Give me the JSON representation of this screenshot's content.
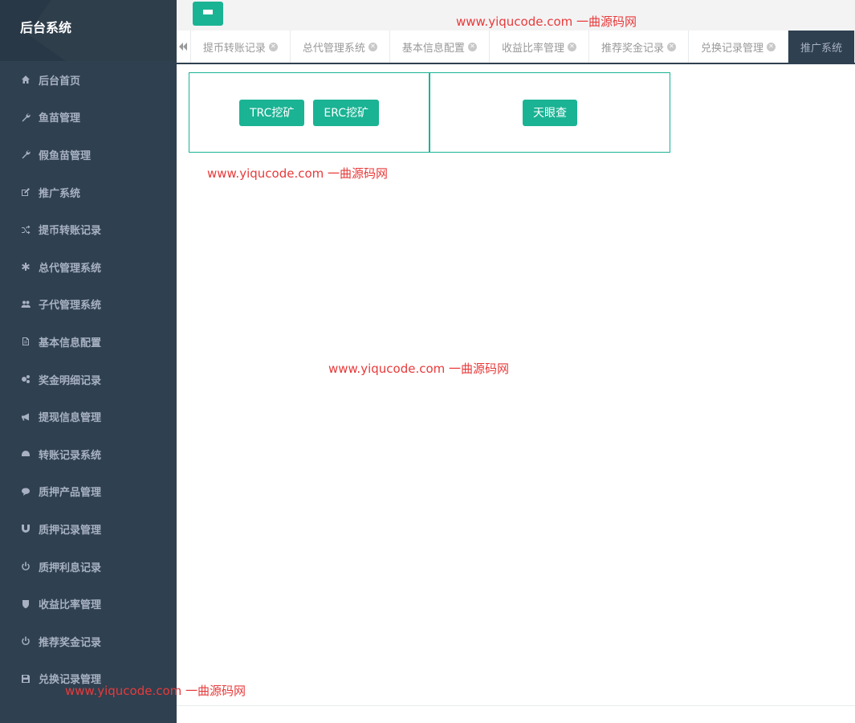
{
  "brand": {
    "title": "后台系统"
  },
  "sidebar": {
    "items": [
      {
        "label": "后台首页",
        "icon": "home-icon"
      },
      {
        "label": "鱼苗管理",
        "icon": "wrench-icon"
      },
      {
        "label": "假鱼苗管理",
        "icon": "wrench-icon"
      },
      {
        "label": "推广系统",
        "icon": "edit-icon"
      },
      {
        "label": "提币转账记录",
        "icon": "shuffle-icon"
      },
      {
        "label": "总代管理系统",
        "icon": "asterisk-icon"
      },
      {
        "label": "子代管理系统",
        "icon": "users-icon"
      },
      {
        "label": "基本信息配置",
        "icon": "file-icon"
      },
      {
        "label": "奖金明细记录",
        "icon": "cogs-icon"
      },
      {
        "label": "提现信息管理",
        "icon": "bullhorn-icon"
      },
      {
        "label": "转账记录系统",
        "icon": "dashboard-icon"
      },
      {
        "label": "质押产品管理",
        "icon": "comment-icon"
      },
      {
        "label": "质押记录管理",
        "icon": "magnet-icon"
      },
      {
        "label": "质押利息记录",
        "icon": "power-icon"
      },
      {
        "label": "收益比率管理",
        "icon": "shield-icon"
      },
      {
        "label": "推荐奖金记录",
        "icon": "power-icon"
      },
      {
        "label": "兑换记录管理",
        "icon": "save-icon"
      }
    ]
  },
  "tabs": [
    {
      "label": "提币转账记录",
      "closable": true,
      "active": false
    },
    {
      "label": "总代管理系统",
      "closable": true,
      "active": false
    },
    {
      "label": "基本信息配置",
      "closable": true,
      "active": false
    },
    {
      "label": "收益比率管理",
      "closable": true,
      "active": false
    },
    {
      "label": "推荐奖金记录",
      "closable": true,
      "active": false
    },
    {
      "label": "兑换记录管理",
      "closable": true,
      "active": false
    },
    {
      "label": "推广系统",
      "closable": false,
      "active": true
    }
  ],
  "content": {
    "panel_a_buttons": [
      "TRC挖矿",
      "ERC挖矿"
    ],
    "panel_b_buttons": [
      "天眼查"
    ]
  },
  "watermark": "www.yiqucode.com  一曲源码网",
  "colors": {
    "accent": "#1ab394",
    "sidebar": "#2f4050",
    "watermark": "#e83a3a"
  }
}
